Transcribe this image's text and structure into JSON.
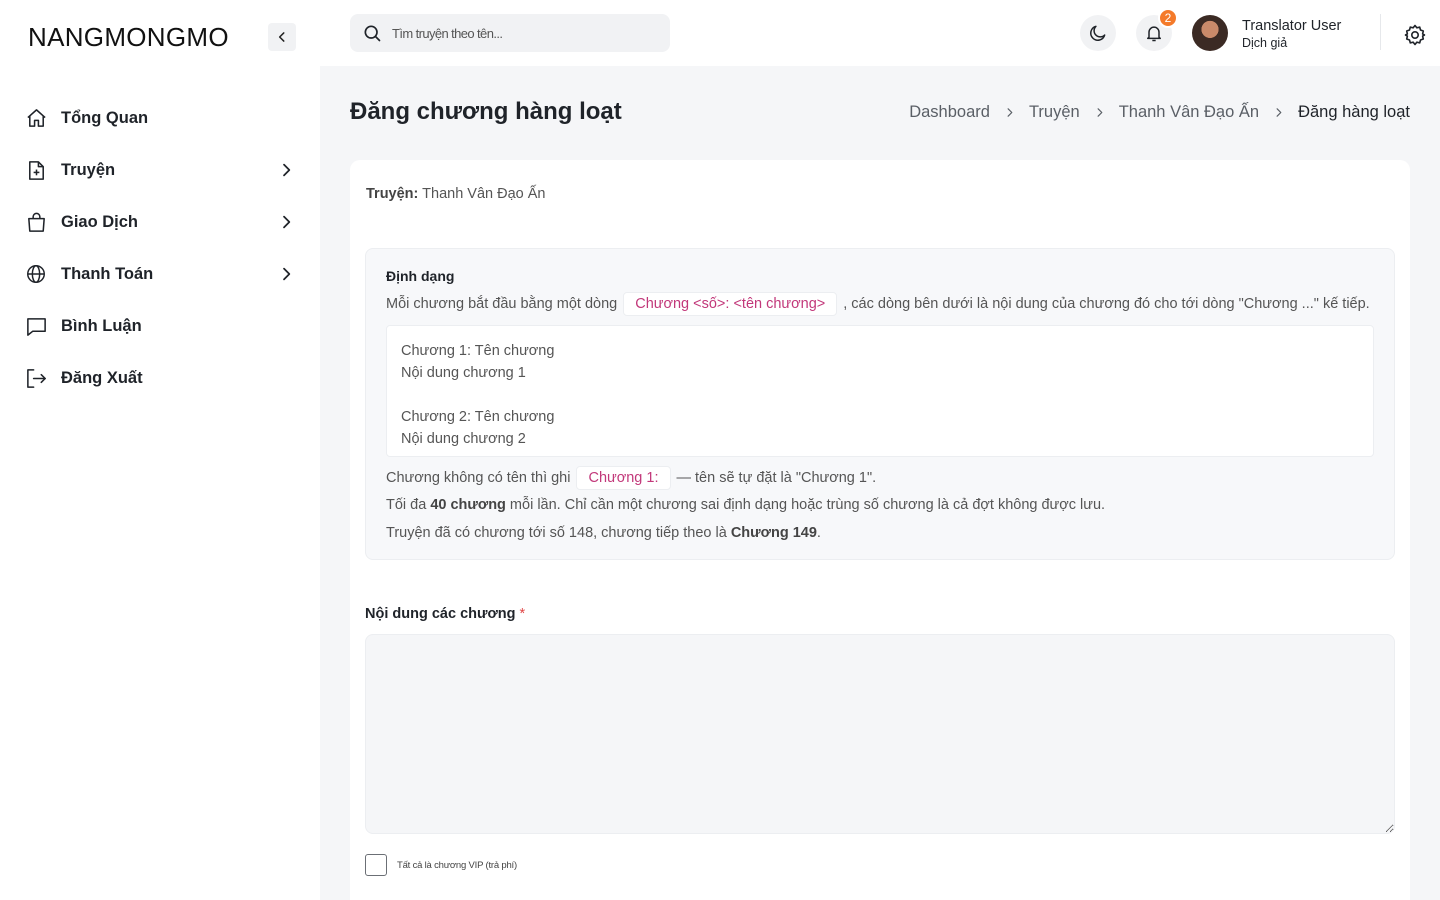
{
  "brand": "NANGMONGMO",
  "sidebar": {
    "items": [
      {
        "label": "Tổng Quan",
        "icon": "home-icon",
        "has_submenu": false
      },
      {
        "label": "Truyện",
        "icon": "file-plus-icon",
        "has_submenu": true
      },
      {
        "label": "Giao Dịch",
        "icon": "shopping-bag-icon",
        "has_submenu": true
      },
      {
        "label": "Thanh Toán",
        "icon": "globe-icon",
        "has_submenu": true
      },
      {
        "label": "Bình Luận",
        "icon": "message-square-icon",
        "has_submenu": false
      },
      {
        "label": "Đăng Xuất",
        "icon": "logout-icon",
        "has_submenu": false
      }
    ]
  },
  "header": {
    "search_placeholder": "Tìm truyện theo tên...",
    "notification_count": "2",
    "user_name": "Translator User",
    "user_role": "Dịch giả"
  },
  "page": {
    "title": "Đăng chương hàng loạt",
    "breadcrumb": [
      "Dashboard",
      "Truyện",
      "Thanh Vân Đạo Ấn",
      "Đăng hàng loạt"
    ]
  },
  "story": {
    "label": "Truyện:",
    "name": "Thanh Vân Đạo Ấn"
  },
  "format": {
    "title": "Định dạng",
    "desc_before": "Mỗi chương bắt đầu bằng một dòng",
    "desc_code": "Chương <số>: <tên chương>",
    "desc_after": ", các dòng bên dưới là nội dung của chương đó cho tới dòng \"Chương ...\" kế tiếp.",
    "example": {
      "line1": "Chương 1: Tên chương",
      "line2": "Nội dung chương 1",
      "line3": "Chương 2: Tên chương",
      "line4": "Nội dung chương 2"
    },
    "note1_before": "Chương không có tên thì ghi",
    "note1_code": "Chương 1:",
    "note1_after": "— tên sẽ tự đặt là \"Chương 1\".",
    "note2_before": "Tối đa",
    "note2_bold": "40 chương",
    "note2_after": "mỗi lần. Chỉ cần một chương sai định dạng hoặc trùng số chương là cả đợt không được lưu.",
    "note3_before": "Truyện đã có chương tới số 148, chương tiếp theo là",
    "note3_bold": "Chương 149",
    "note3_after": "."
  },
  "form": {
    "content_label": "Nội dung các chương",
    "required_mark": "*",
    "content_value": "",
    "vip_label": "Tất cả là chương VIP (trả phí)",
    "vip_checked": false
  },
  "colors": {
    "accent_code": "#c2387a",
    "badge": "#f47a2a",
    "required": "#e04646"
  }
}
